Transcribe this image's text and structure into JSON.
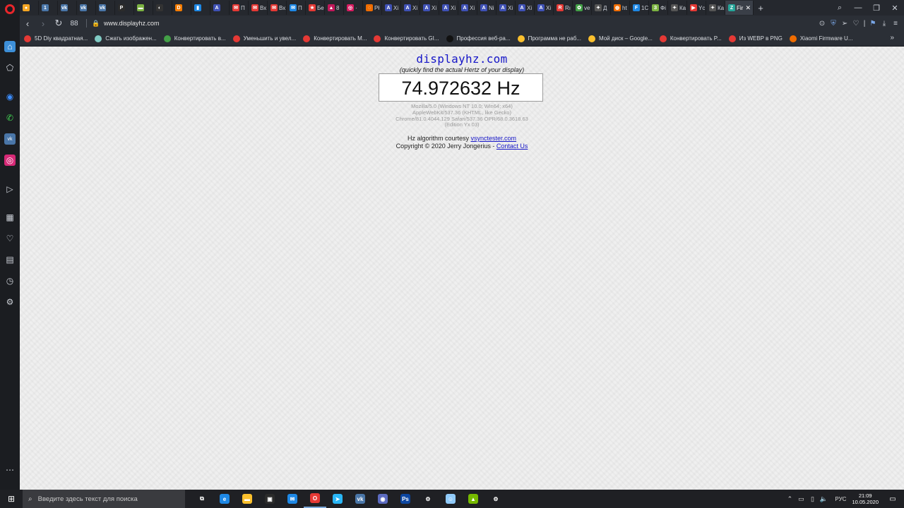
{
  "browser": {
    "tabs": [
      {
        "label": "",
        "color": "#f5a623",
        "glyph": "●"
      },
      {
        "label": "",
        "color": "#4a76a8",
        "glyph": "1"
      },
      {
        "label": "",
        "color": "#4a76a8",
        "glyph": "vk"
      },
      {
        "label": "",
        "color": "#4a76a8",
        "glyph": "vk"
      },
      {
        "label": "",
        "color": "#4a76a8",
        "glyph": "vk"
      },
      {
        "label": "",
        "color": "#2b2b2b",
        "glyph": "P"
      },
      {
        "label": "",
        "color": "#7cb342",
        "glyph": "▬"
      },
      {
        "label": "",
        "color": "#333333",
        "glyph": "◐"
      },
      {
        "label": "",
        "color": "#f57c00",
        "glyph": "D"
      },
      {
        "label": "",
        "color": "#1e88e5",
        "glyph": "▮"
      },
      {
        "label": "",
        "color": "#3f51b5",
        "glyph": "A"
      },
      {
        "label": "П",
        "color": "#e53935",
        "glyph": "✉"
      },
      {
        "label": "Вх",
        "color": "#e53935",
        "glyph": "✉"
      },
      {
        "label": "Вх",
        "color": "#e53935",
        "glyph": "✉"
      },
      {
        "label": "П",
        "color": "#1e88e5",
        "glyph": "✉"
      },
      {
        "label": "Бе",
        "color": "#e53935",
        "glyph": "★"
      },
      {
        "label": "8",
        "color": "#c2185b",
        "glyph": "▲"
      },
      {
        "label": "·",
        "color": "#d81b60",
        "glyph": "◎"
      },
      {
        "label": "Pł",
        "color": "#ef6c00",
        "glyph": "◌"
      },
      {
        "label": "Xi",
        "color": "#3f51b5",
        "glyph": "A"
      },
      {
        "label": "Xi",
        "color": "#3f51b5",
        "glyph": "A"
      },
      {
        "label": "Xi",
        "color": "#3f51b5",
        "glyph": "A"
      },
      {
        "label": "Xi",
        "color": "#3f51b5",
        "glyph": "A"
      },
      {
        "label": "Xi",
        "color": "#3f51b5",
        "glyph": "A"
      },
      {
        "label": "Ni",
        "color": "#3f51b5",
        "glyph": "A"
      },
      {
        "label": "Xi",
        "color": "#3f51b5",
        "glyph": "A"
      },
      {
        "label": "Xi",
        "color": "#3f51b5",
        "glyph": "A"
      },
      {
        "label": "Xi",
        "color": "#3f51b5",
        "glyph": "A"
      },
      {
        "label": "Rı",
        "color": "#e53935",
        "glyph": "R"
      },
      {
        "label": "ve",
        "color": "#43a047",
        "glyph": "✿"
      },
      {
        "label": "Д",
        "color": "#555555",
        "glyph": "✦"
      },
      {
        "label": "ht",
        "color": "#ef6c00",
        "glyph": "◍"
      },
      {
        "label": "1C",
        "color": "#1e88e5",
        "glyph": "F"
      },
      {
        "label": "Фі",
        "color": "#7cb342",
        "glyph": "З"
      },
      {
        "label": "Ка",
        "color": "#555555",
        "glyph": "✦"
      },
      {
        "label": "Yc",
        "color": "#e53935",
        "glyph": "▶"
      },
      {
        "label": "Ка",
        "color": "#555555",
        "glyph": "✦"
      }
    ],
    "active_tab": {
      "label": "Fir",
      "color": "#26a69a",
      "glyph": "Z"
    },
    "speed_dial": "88",
    "url": "www.displayhz.com",
    "bookmarks": [
      {
        "label": "5D Diy квадратная...",
        "color": "#e53935"
      },
      {
        "label": "Сжать изображен...",
        "color": "#80cbc4"
      },
      {
        "label": "Конвертировать в...",
        "color": "#43a047"
      },
      {
        "label": "Уменьшить и увел...",
        "color": "#e53935"
      },
      {
        "label": "Конвертировать M...",
        "color": "#e53935"
      },
      {
        "label": "Конвертировать GI...",
        "color": "#e53935"
      },
      {
        "label": "Профессия веб-ра...",
        "color": "#111111"
      },
      {
        "label": "Программа не раб...",
        "color": "#fbc02d"
      },
      {
        "label": "Мой диск – Google...",
        "color": "#fbc02d"
      },
      {
        "label": "Конвертировать P...",
        "color": "#e53935"
      },
      {
        "label": "Из WEBP в PNG",
        "color": "#e53935"
      },
      {
        "label": "Xiaomi Firmware U...",
        "color": "#ef6c00"
      }
    ]
  },
  "page": {
    "title": "displayhz.com",
    "subtitle": "(quickly find the actual Hertz of your display)",
    "hz_value": "74.972632 Hz",
    "ua_lines": [
      "Mozilla/5.0 (Windows NT 10.0; Win64; x64)",
      "AppleWebKit/537.36 (KHTML, like Gecko)",
      "Chrome/81.0.4044.129 Safari/537.36 OPR/68.0.3618.63",
      "(Edition Yx 03)"
    ],
    "credit_prefix": "Hz algorithm courtesy",
    "credit_link": "vsynctester.com",
    "copyright": "Copyright © 2020 Jerry Jongerius -",
    "contact_link": "Contact Us"
  },
  "taskbar": {
    "search_placeholder": "Введите здесь текст для поиска",
    "apps": [
      {
        "name": "task-view",
        "color": "transparent",
        "glyph": "⧉"
      },
      {
        "name": "edge",
        "color": "#1e88e5",
        "glyph": "e"
      },
      {
        "name": "explorer",
        "color": "#fbc02d",
        "glyph": "▬"
      },
      {
        "name": "store",
        "color": "#2b2b2b",
        "glyph": "▣"
      },
      {
        "name": "mail",
        "color": "#1e88e5",
        "glyph": "✉"
      },
      {
        "name": "opera",
        "color": "#e53935",
        "glyph": "O"
      },
      {
        "name": "telegram",
        "color": "#29b6f6",
        "glyph": "➤"
      },
      {
        "name": "vk",
        "color": "#4a76a8",
        "glyph": "vk"
      },
      {
        "name": "discord",
        "color": "#5c6bc0",
        "glyph": "◉"
      },
      {
        "name": "photoshop",
        "color": "#0d47a1",
        "glyph": "Ps"
      },
      {
        "name": "control",
        "color": "transparent",
        "glyph": "⚙"
      },
      {
        "name": "messenger",
        "color": "#90caf9",
        "glyph": "☺"
      },
      {
        "name": "nvidia",
        "color": "#76b900",
        "glyph": "▲"
      },
      {
        "name": "settings",
        "color": "transparent",
        "glyph": "⚙"
      }
    ],
    "lang": "РУС",
    "time": "21:09",
    "date": "10.05.2020"
  }
}
